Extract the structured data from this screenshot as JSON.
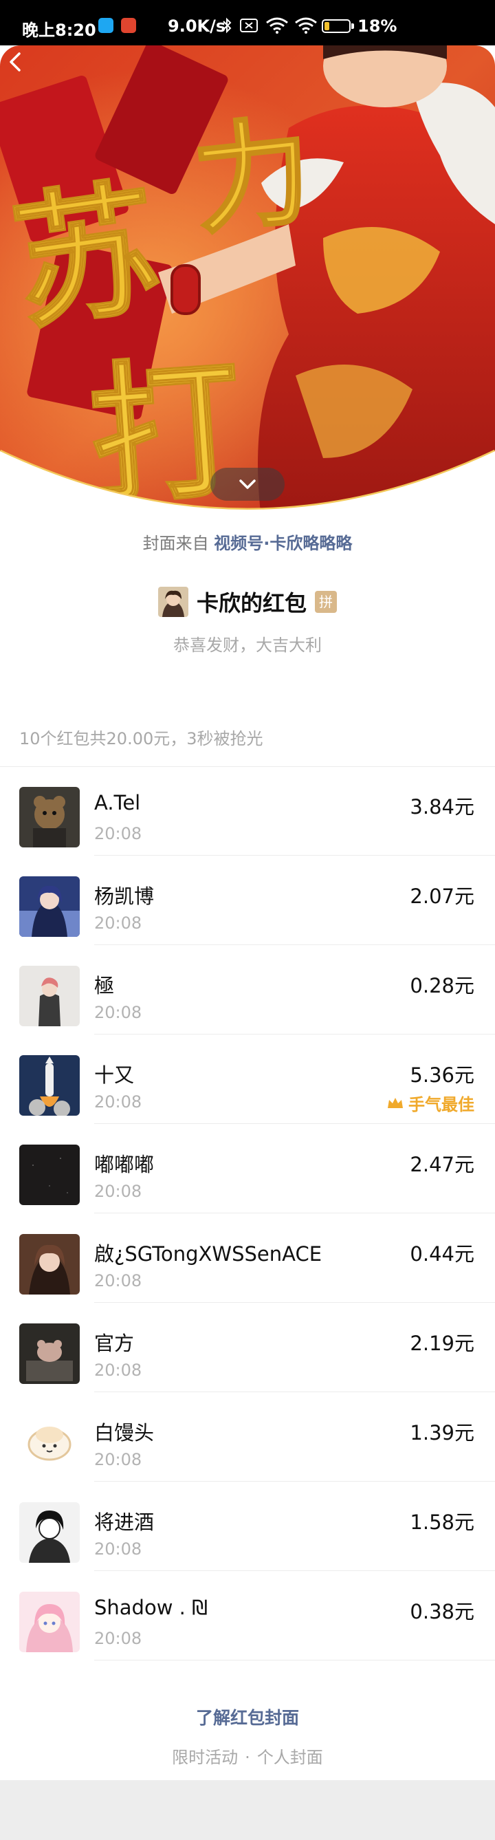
{
  "status_bar": {
    "time": "晚上8:20",
    "net_speed": "9.0K/s",
    "battery_text": "18%",
    "battery_level": 0.18,
    "icons": [
      "bluetooth-icon",
      "no-sim-icon",
      "wifi-icon",
      "wifi-icon",
      "battery-icon"
    ]
  },
  "cover": {
    "calligraphy": [
      "苏",
      "打",
      "力"
    ]
  },
  "source": {
    "prefix": "封面来自",
    "link": "视频号·卡欣略略略"
  },
  "sender": {
    "name": "卡欣的红包",
    "badge": "拼",
    "blessing": "恭喜发财，大吉大利"
  },
  "summary": "10个红包共20.00元，3秒被抢光",
  "entries": [
    {
      "name": "A.Tel",
      "time": "20:08",
      "amount": "3.84元"
    },
    {
      "name": "杨凯博",
      "time": "20:08",
      "amount": "2.07元"
    },
    {
      "name": "極",
      "time": "20:08",
      "amount": "0.28元"
    },
    {
      "name": "十又",
      "time": "20:08",
      "amount": "5.36元",
      "best": "手气最佳"
    },
    {
      "name": "嘟嘟嘟",
      "time": "20:08",
      "amount": "2.47元"
    },
    {
      "name": "啟¿SGTongXWSSenACE",
      "time": "20:08",
      "amount": "0.44元"
    },
    {
      "name": "官方",
      "time": "20:08",
      "amount": "2.19元"
    },
    {
      "name": "白馒头",
      "time": "20:08",
      "amount": "1.39元"
    },
    {
      "name": "将进酒",
      "time": "20:08",
      "amount": "1.58元"
    },
    {
      "name": "Shadow . ₪",
      "time": "20:08",
      "amount": "0.38元"
    }
  ],
  "footer": {
    "link": "了解红包封面",
    "sub_left": "限时活动",
    "separator": "·",
    "sub_right": "个人封面"
  },
  "colors": {
    "link_blue": "#576b95",
    "best_gold": "#f0a92b",
    "cover_red": "#c8261c",
    "calligraphy_gold": "#f1c232"
  }
}
